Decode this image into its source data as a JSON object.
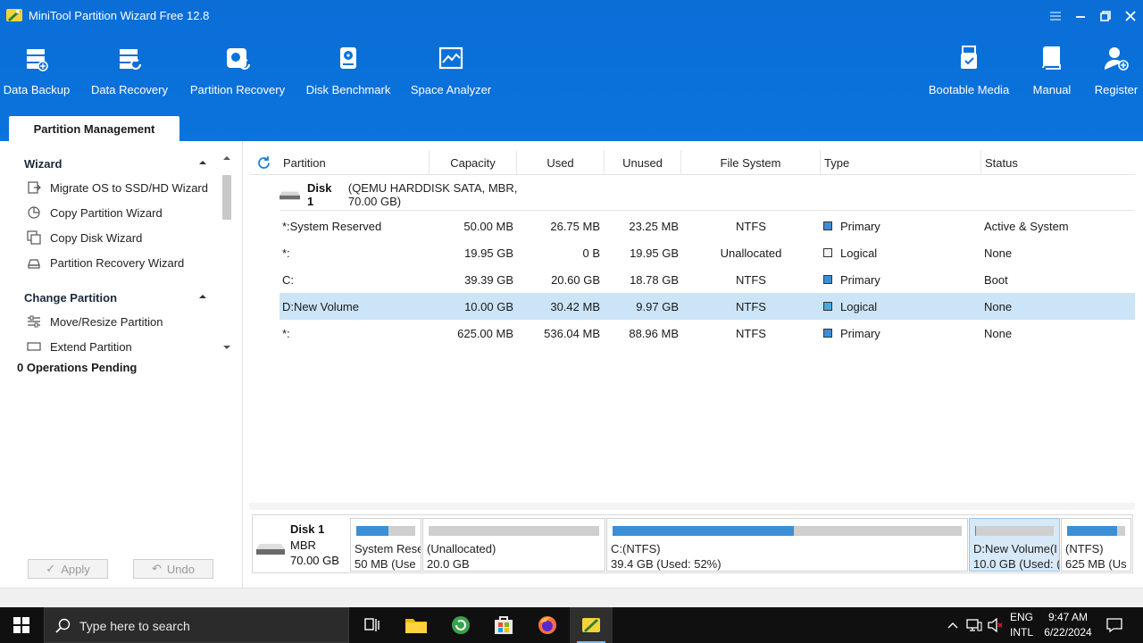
{
  "window": {
    "title": "MiniTool Partition Wizard Free 12.8"
  },
  "toolbar": {
    "left": [
      {
        "label": "Data Backup",
        "icon": "data-backup-icon"
      },
      {
        "label": "Data Recovery",
        "icon": "data-recovery-icon"
      },
      {
        "label": "Partition Recovery",
        "icon": "partition-recovery-icon"
      },
      {
        "label": "Disk Benchmark",
        "icon": "disk-benchmark-icon"
      },
      {
        "label": "Space Analyzer",
        "icon": "space-analyzer-icon"
      }
    ],
    "right": [
      {
        "label": "Bootable Media",
        "icon": "bootable-media-icon"
      },
      {
        "label": "Manual",
        "icon": "manual-icon"
      },
      {
        "label": "Register",
        "icon": "register-icon"
      }
    ]
  },
  "tab": {
    "label": "Partition Management"
  },
  "sidebar": {
    "sections": [
      {
        "title": "Wizard",
        "items": [
          {
            "label": "Migrate OS to SSD/HD Wizard",
            "icon": "migrate-os-icon"
          },
          {
            "label": "Copy Partition Wizard",
            "icon": "copy-partition-icon"
          },
          {
            "label": "Copy Disk Wizard",
            "icon": "copy-disk-icon"
          },
          {
            "label": "Partition Recovery Wizard",
            "icon": "partition-recovery-wizard-icon"
          }
        ]
      },
      {
        "title": "Change Partition",
        "items": [
          {
            "label": "Move/Resize Partition",
            "icon": "move-resize-icon"
          },
          {
            "label": "Extend Partition",
            "icon": "extend-partition-icon"
          }
        ]
      }
    ],
    "ops_pending": "0 Operations Pending",
    "apply_label": "Apply",
    "undo_label": "Undo"
  },
  "table": {
    "columns": [
      "Partition",
      "Capacity",
      "Used",
      "Unused",
      "File System",
      "Type",
      "Status"
    ],
    "disk": {
      "name": "Disk 1",
      "desc": "(QEMU HARDDISK SATA, MBR, 70.00 GB)"
    },
    "rows": [
      {
        "partition": "*:System Reserved",
        "capacity": "50.00 MB",
        "used": "26.75 MB",
        "unused": "23.25 MB",
        "fs": "NTFS",
        "type": "Primary",
        "status": "Active & System",
        "color": "#3b8fd6",
        "selected": false
      },
      {
        "partition": "*:",
        "capacity": "19.95 GB",
        "used": "0 B",
        "unused": "19.95 GB",
        "fs": "Unallocated",
        "type": "Logical",
        "status": "None",
        "color": "#f5f5f5",
        "selected": false
      },
      {
        "partition": "C:",
        "capacity": "39.39 GB",
        "used": "20.60 GB",
        "unused": "18.78 GB",
        "fs": "NTFS",
        "type": "Primary",
        "status": "Boot",
        "color": "#3b8fd6",
        "selected": false
      },
      {
        "partition": "D:New Volume",
        "capacity": "10.00 GB",
        "used": "30.42 MB",
        "unused": "9.97 GB",
        "fs": "NTFS",
        "type": "Logical",
        "status": "None",
        "color": "#44a9e6",
        "selected": true
      },
      {
        "partition": "*:",
        "capacity": "625.00 MB",
        "used": "536.04 MB",
        "unused": "88.96 MB",
        "fs": "NTFS",
        "type": "Primary",
        "status": "None",
        "color": "#3b8fd6",
        "selected": false
      }
    ]
  },
  "diskmap": {
    "disk": {
      "name": "Disk 1",
      "scheme": "MBR",
      "size": "70.00 GB"
    },
    "segments": [
      {
        "line1": "System Rese",
        "line2": "50 MB (Use",
        "used_fraction": 0.54,
        "selected": false
      },
      {
        "line1": "(Unallocated)",
        "line2": "20.0 GB",
        "used_fraction": 0,
        "selected": false
      },
      {
        "line1": "C:(NTFS)",
        "line2": "39.4 GB (Used: 52%)",
        "used_fraction": 0.52,
        "selected": false
      },
      {
        "line1": "D:New Volume(I",
        "line2": "10.0 GB (Used: (",
        "used_fraction": 0.003,
        "selected": true
      },
      {
        "line1": "(NTFS)",
        "line2": "625 MB (Us",
        "used_fraction": 0.86,
        "selected": false
      }
    ]
  },
  "taskbar": {
    "search_placeholder": "Type here to search",
    "lang_top": "ENG",
    "lang_bottom": "INTL",
    "time": "9:47 AM",
    "date": "6/22/2024"
  },
  "colors": {
    "accent": "#0b73dd",
    "selection": "#cce4f7",
    "partition_blue": "#3b8fd6",
    "taskbar": "#101010"
  }
}
